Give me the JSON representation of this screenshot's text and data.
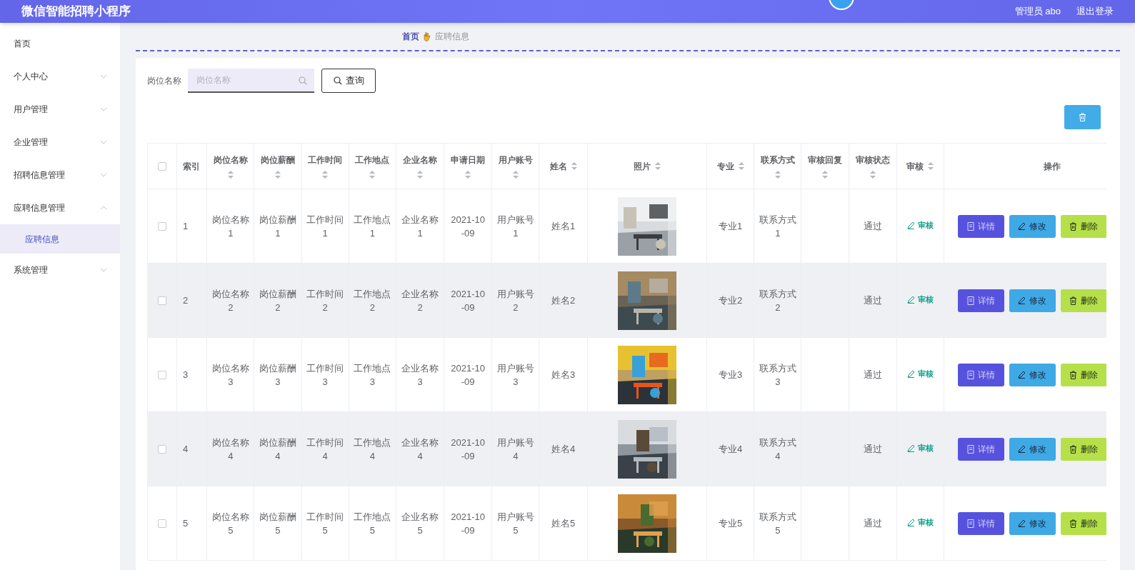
{
  "app_title": "微信智能招聘小程序",
  "user": "管理员 abo",
  "logout": "退出登录",
  "sidebar": {
    "items": [
      {
        "label": "首页",
        "kind": "link",
        "selected": false
      },
      {
        "label": "个人中心",
        "kind": "group",
        "expanded": false
      },
      {
        "label": "用户管理",
        "kind": "group",
        "expanded": false
      },
      {
        "label": "企业管理",
        "kind": "group",
        "expanded": false
      },
      {
        "label": "招聘信息管理",
        "kind": "group",
        "expanded": false
      },
      {
        "label": "应聘信息管理",
        "kind": "group",
        "expanded": true,
        "children": [
          {
            "label": "应聘信息",
            "selected": true
          }
        ]
      },
      {
        "label": "系统管理",
        "kind": "group",
        "expanded": false
      }
    ]
  },
  "breadcrumb": [
    "首页",
    "应聘信息"
  ],
  "search": {
    "label": "岗位名称",
    "placeholder": "岗位名称",
    "button": "查询"
  },
  "table": {
    "select_all_checked": false,
    "columns": [
      {
        "label": "索引",
        "sortable": false
      },
      {
        "label": "岗位名称",
        "sortable": true
      },
      {
        "label": "岗位薪酬",
        "sortable": true
      },
      {
        "label": "工作时间",
        "sortable": true
      },
      {
        "label": "工作地点",
        "sortable": true
      },
      {
        "label": "企业名称",
        "sortable": true
      },
      {
        "label": "申请日期",
        "sortable": true
      },
      {
        "label": "用户账号",
        "sortable": true
      },
      {
        "label": "姓名",
        "sortable": true
      },
      {
        "label": "照片",
        "sortable": true
      },
      {
        "label": "专业",
        "sortable": true
      },
      {
        "label": "联系方式",
        "sortable": true
      },
      {
        "label": "审核回复",
        "sortable": true
      },
      {
        "label": "审核状态",
        "sortable": true
      },
      {
        "label": "审核",
        "sortable": true
      },
      {
        "label": "操作",
        "sortable": false
      }
    ],
    "rows": [
      {
        "checked": false,
        "cells": [
          "1",
          "岗位名称1",
          "岗位薪酬1",
          "工作时间1",
          "工作地点1",
          "企业名称1",
          "2021-10-09",
          "用户账号1",
          "姓名1"
        ],
        "info": {
          "major": "专业1",
          "contact": "联系方式1",
          "status": "通过"
        },
        "review": "审核",
        "actions": [
          {
            "kind": "detail",
            "label": "详情"
          },
          {
            "kind": "edit",
            "label": "修改"
          },
          {
            "kind": "delete",
            "label": "删除"
          }
        ]
      },
      {
        "checked": false,
        "cells": [
          "2",
          "岗位名称2",
          "岗位薪酬2",
          "工作时间2",
          "工作地点2",
          "企业名称2",
          "2021-10-09",
          "用户账号2",
          "姓名2"
        ],
        "info": {
          "major": "专业2",
          "contact": "联系方式2",
          "status": "通过"
        },
        "review": "审核",
        "actions": [
          {
            "kind": "detail",
            "label": "详情"
          },
          {
            "kind": "edit",
            "label": "修改"
          },
          {
            "kind": "delete",
            "label": "删除"
          }
        ]
      },
      {
        "checked": false,
        "cells": [
          "3",
          "岗位名称3",
          "岗位薪酬3",
          "工作时间3",
          "工作地点3",
          "企业名称3",
          "2021-10-09",
          "用户账号3",
          "姓名3"
        ],
        "info": {
          "major": "专业3",
          "contact": "联系方式3",
          "status": "通过"
        },
        "review": "审核",
        "actions": [
          {
            "kind": "detail",
            "label": "详情"
          },
          {
            "kind": "edit",
            "label": "修改"
          },
          {
            "kind": "delete",
            "label": "删除"
          }
        ]
      },
      {
        "checked": false,
        "cells": [
          "4",
          "岗位名称4",
          "岗位薪酬4",
          "工作时间4",
          "工作地点4",
          "企业名称4",
          "2021-10-09",
          "用户账号4",
          "姓名4"
        ],
        "info": {
          "major": "专业4",
          "contact": "联系方式4",
          "status": "通过"
        },
        "review": "审核",
        "actions": [
          {
            "kind": "detail",
            "label": "详情"
          },
          {
            "kind": "edit",
            "label": "修改"
          },
          {
            "kind": "delete",
            "label": "删除"
          }
        ]
      },
      {
        "checked": false,
        "cells": [
          "5",
          "岗位名称5",
          "岗位薪酬5",
          "工作时间5",
          "工作地点5",
          "企业名称5",
          "2021-10-09",
          "用户账号5",
          "姓名5"
        ],
        "info": {
          "major": "专业5",
          "contact": "联系方式5",
          "status": "通过"
        },
        "review": "审核",
        "actions": [
          {
            "kind": "detail",
            "label": "详情"
          },
          {
            "kind": "edit",
            "label": "修改"
          },
          {
            "kind": "delete",
            "label": "删除"
          }
        ]
      }
    ]
  }
}
